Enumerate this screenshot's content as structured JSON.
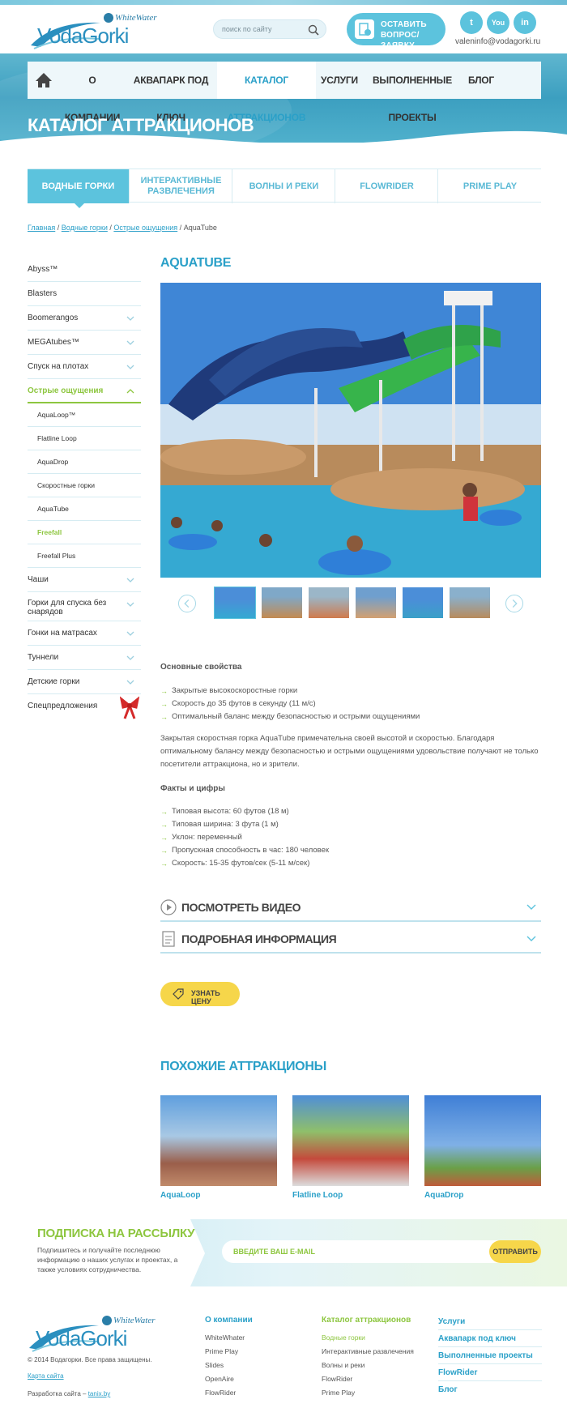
{
  "header": {
    "logo_brand": "VodaGorki",
    "logo_partner": "WhiteWater",
    "search_placeholder": "поиск по сайту",
    "request_line1": "Оставить",
    "request_line2": "вопрос/заявку",
    "email": "valeninfo@vodagorki.ru",
    "social": [
      "twitter-icon",
      "youtube-icon",
      "linkedin-icon"
    ],
    "social_labels": [
      "t",
      "You",
      "in"
    ]
  },
  "nav": {
    "items": [
      "О компании",
      "Аквапарк под ключ",
      "Каталог аттракционов",
      "Услуги",
      "Выполненные проекты",
      "Блог"
    ],
    "active_index": 2
  },
  "hero": {
    "title": "Каталог аттракционов"
  },
  "categories": [
    "Водные горки",
    "Интерактивные развлечения",
    "Волны и реки",
    "FlowRider",
    "Prime Play"
  ],
  "breadcrumb": {
    "items": [
      "Главная",
      "Водные горки",
      "Острые ощущения"
    ],
    "current": "AquaTube",
    "sep": " / "
  },
  "sidebar": {
    "items": [
      {
        "label": "Abyss™"
      },
      {
        "label": "Blasters"
      },
      {
        "label": "Boomerangos",
        "chevron": true
      },
      {
        "label": "MEGAtubes™",
        "chevron": true
      },
      {
        "label": "Спуск на плотах",
        "chevron": true
      },
      {
        "label": "Острые ощущения",
        "chevron": true,
        "active": true
      }
    ],
    "sub": [
      {
        "label": "AquaLoop™"
      },
      {
        "label": "Flatline Loop"
      },
      {
        "label": "AquaDrop"
      },
      {
        "label": "Скоростные горки"
      },
      {
        "label": "AquaTube"
      },
      {
        "label": "Freefall",
        "active": true
      },
      {
        "label": "Freefall Plus"
      }
    ],
    "items2": [
      {
        "label": "Чаши",
        "chevron": true
      },
      {
        "label": "Горки для спуска без снарядов",
        "chevron": true
      },
      {
        "label": "Гонки на матрасах",
        "chevron": true
      },
      {
        "label": "Туннели",
        "chevron": true
      },
      {
        "label": "Детские горки",
        "chevron": true
      },
      {
        "label": "Спецпредложения"
      }
    ]
  },
  "product": {
    "title": "AquaTube",
    "features_title": "Основные свойства",
    "features": [
      "Закрытые высокоскоростные горки",
      "Скорость до 35 футов в секунду (11 м/с)",
      "Оптимальный баланс между безопасностью и острыми ощущениями"
    ],
    "description": "Закрытая скоростная горка AquaTube примечательна своей высотой и скоростью. Благодаря оптимальному балансу между безопасностью и острыми ощущениями удовольствие получают не только посетители аттракциона, но и зрители.",
    "facts_title": "Факты и цифры",
    "facts": [
      "Типовая высота: 60 футов (18 м)",
      "Типовая ширина: 3 фута (1 м)",
      "Уклон: переменный",
      "Пропускная способность в час: 180 человек",
      "Скорость: 15-35 футов/сек (5-11 м/сек)"
    ],
    "accordion": [
      "Посмотреть видео",
      "Подробная информация"
    ],
    "price_button": "Узнать цену"
  },
  "similar": {
    "title": "Похожие аттракционы",
    "items": [
      "AquaLoop",
      "Flatline Loop",
      "AquaDrop"
    ]
  },
  "subscribe": {
    "title": "Подписка на рассылку",
    "text": "Подпишитесь и получайте последнюю информацию о наших услугах и проектах, а также условиях сотрудничества.",
    "placeholder": "Введите ваш e-mail",
    "button": "Отправить"
  },
  "footer": {
    "copyright": "© 2014 Водагорки. Все права защищены.",
    "sitemap": "Карта сайта",
    "dev_prefix": "Разработка сайта – ",
    "dev_link": "tanix.by",
    "col1": {
      "title": "О компании",
      "links": [
        "WhiteWhater",
        "Prime Play",
        "Slides",
        "OpenAire",
        "FlowRider"
      ]
    },
    "col2": {
      "title": "Каталог аттракционов",
      "links": [
        "Водные горки",
        "Интерактивные развлечения",
        "Волны и реки",
        "FlowRider",
        "Prime Play"
      ]
    },
    "col3": [
      "Услуги",
      "Аквапарк под ключ",
      "Выполненные проекты",
      "FlowRider",
      "Блог"
    ]
  },
  "colors": {
    "accent": "#5cc3dd",
    "link": "#2aa0c8",
    "green": "#8dc63f",
    "yellow": "#f6d64a"
  }
}
